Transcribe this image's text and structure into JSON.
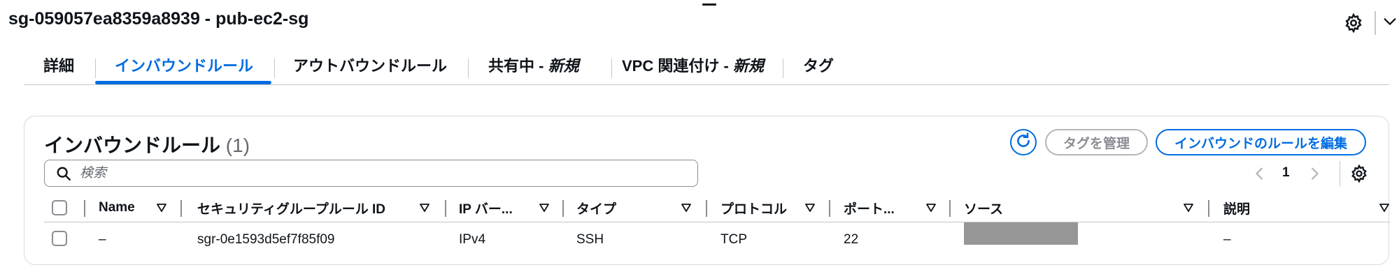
{
  "header": {
    "title": "sg-059057ea8359a8939 - pub-ec2-sg"
  },
  "tabs": [
    {
      "label": "詳細"
    },
    {
      "label": "インバウンドルール",
      "active": true
    },
    {
      "label": "アウトバウンドルール"
    },
    {
      "label": "共有中 - ",
      "badge": "新規"
    },
    {
      "label": "VPC 関連付け - ",
      "badge": "新規"
    },
    {
      "label": "タグ"
    }
  ],
  "panel": {
    "title": "インバウンドルール",
    "count": "(1)",
    "buttons": {
      "manage_tags": "タグを管理",
      "edit_inbound": "インバウンドのルールを編集"
    },
    "search": {
      "placeholder": "検索",
      "value": ""
    },
    "pagination": {
      "current_page": "1"
    },
    "columns": [
      "Name",
      "セキュリティグループルール ID",
      "IP バー...",
      "タイプ",
      "プロトコル",
      "ポート...",
      "ソース",
      "説明"
    ],
    "rows": [
      {
        "name": "–",
        "rule_id": "sgr-0e1593d5ef7f85f09",
        "ip_version": "IPv4",
        "type": "SSH",
        "protocol": "TCP",
        "port": "22",
        "source": "",
        "description": "–"
      }
    ]
  },
  "colors": {
    "accent": "#006ce0",
    "text": "#0f141a",
    "border": "#c6c6cd",
    "disabled": "#b4b4bb",
    "redacted": "#969696"
  },
  "icons": {
    "top_settings": "gear-icon",
    "collapse": "chevron-down-icon",
    "refresh": "refresh-icon",
    "search": "search-icon",
    "prev": "chevron-left-icon",
    "next": "chevron-right-icon",
    "table_settings": "gear-icon",
    "sort": "caret-down-icon"
  }
}
